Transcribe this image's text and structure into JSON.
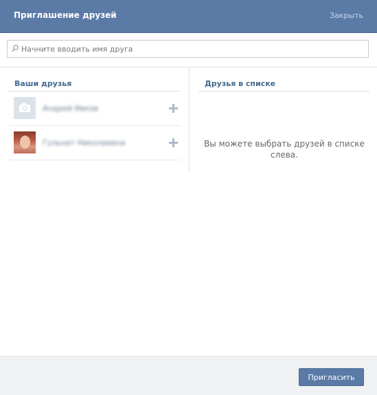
{
  "header": {
    "title": "Приглашение друзей",
    "close_label": "Закрыть"
  },
  "search": {
    "placeholder": "Начните вводить имя друга",
    "value": ""
  },
  "left_column": {
    "heading": "Ваши друзья",
    "friends": [
      {
        "name": "Андрей Ивков",
        "avatar": "camera-placeholder"
      },
      {
        "name": "Гульнат Николаевна",
        "avatar": "photo"
      }
    ]
  },
  "right_column": {
    "heading": "Друзья в списке",
    "empty_message": "Вы можете выбрать друзей в списке слева."
  },
  "footer": {
    "invite_label": "Пригласить"
  },
  "colors": {
    "header_bg": "#5b7aa6",
    "heading_text": "#45688e",
    "button_bg": "#5b7aa6"
  }
}
